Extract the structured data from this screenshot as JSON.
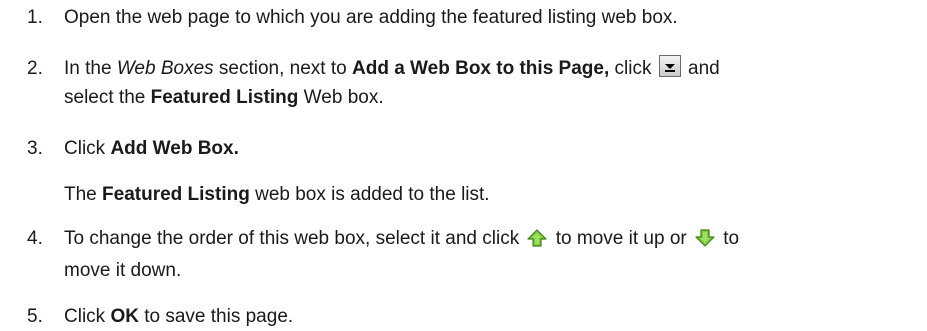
{
  "steps": [
    {
      "num": "1.",
      "text": "Open the web page to which you are adding the featured listing web box."
    },
    {
      "num": "2.",
      "p1": "In the ",
      "section": "Web Boxes",
      "p2": " section, next to ",
      "bold1": "Add a Web Box to this Page,",
      "p3": " click ",
      "p4": " and",
      "p5": "select the ",
      "bold2": "Featured Listing",
      "p6": " Web box."
    },
    {
      "num": "3.",
      "p1": "Click ",
      "bold1": "Add Web Box."
    },
    {
      "result_bold": "Featured Listing",
      "result_pre": "The ",
      "result_post": " web box is added to the list."
    },
    {
      "num": "4.",
      "p1": "To change the order of this web box, select it and click ",
      "p2": " to move it up or ",
      "p3": " to",
      "p4": "move it down."
    },
    {
      "num": "5.",
      "p1": "Click ",
      "bold1": "OK",
      "p2": " to save this page."
    }
  ],
  "icons": {
    "dropdown": "dropdown-arrow-icon",
    "up": "green-arrow-up-icon",
    "down": "green-arrow-down-icon"
  }
}
